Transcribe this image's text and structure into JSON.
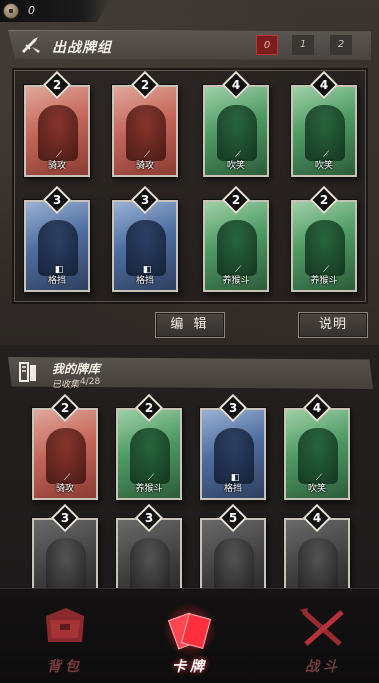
{
  "status_bar": {
    "coin_icon": "coin-icon",
    "coin_count": "0"
  },
  "deck": {
    "title": "出战牌组",
    "tabs": [
      "0",
      "1",
      "2"
    ],
    "active_tab": "0",
    "cards": [
      {
        "cost": "2",
        "label": "骑攻",
        "skill_icon": "sword-icon",
        "theme": "red"
      },
      {
        "cost": "2",
        "label": "骑攻",
        "skill_icon": "sword-icon",
        "theme": "red"
      },
      {
        "cost": "4",
        "label": "吹笑",
        "skill_icon": "scroll-icon",
        "theme": "green"
      },
      {
        "cost": "4",
        "label": "吹笑",
        "skill_icon": "scroll-icon",
        "theme": "green"
      },
      {
        "cost": "3",
        "label": "格挡",
        "skill_icon": "shield-icon",
        "theme": "blue"
      },
      {
        "cost": "3",
        "label": "格挡",
        "skill_icon": "shield-icon",
        "theme": "blue"
      },
      {
        "cost": "2",
        "label": "养猴斗",
        "skill_icon": "sword-icon",
        "theme": "green"
      },
      {
        "cost": "2",
        "label": "养猴斗",
        "skill_icon": "sword-icon",
        "theme": "green"
      }
    ],
    "edit_label": "编 辑",
    "help_label": "说明"
  },
  "library": {
    "title": "我的牌库",
    "collected_label": "已收集",
    "collected_value": "4/28",
    "cards": [
      {
        "cost": "2",
        "label": "骑攻",
        "skill_icon": "sword-icon",
        "theme": "red"
      },
      {
        "cost": "2",
        "label": "养猴斗",
        "skill_icon": "sword-icon",
        "theme": "green"
      },
      {
        "cost": "3",
        "label": "格挡",
        "skill_icon": "shield-icon",
        "theme": "blue"
      },
      {
        "cost": "4",
        "label": "吹笑",
        "skill_icon": "scroll-icon",
        "theme": "green"
      },
      {
        "cost": "3",
        "label": "",
        "theme": "gray"
      },
      {
        "cost": "3",
        "label": "",
        "theme": "gray"
      },
      {
        "cost": "5",
        "label": "",
        "theme": "gray"
      },
      {
        "cost": "4",
        "label": "",
        "theme": "gray"
      }
    ]
  },
  "nav": {
    "items": [
      {
        "label": "背包",
        "icon": "backpack-icon",
        "active": false
      },
      {
        "label": "卡牌",
        "icon": "cards-icon",
        "active": true
      },
      {
        "label": "战斗",
        "icon": "crossed-swords-icon",
        "active": false
      }
    ]
  },
  "colors": {
    "active_red": "#ff3b46",
    "nav_inactive": "#7a3a3a"
  }
}
